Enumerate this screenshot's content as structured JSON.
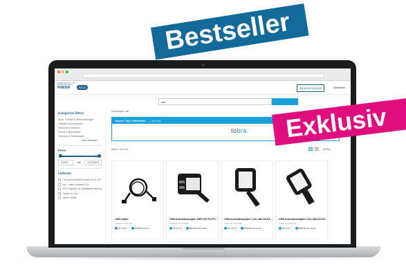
{
  "banners": {
    "bestseller": "Bestseller",
    "exklusiv": "Exklusiv"
  },
  "header": {
    "logo_line1": "PRODUCT",
    "logo_line2": "FINDER",
    "beta": "BETA",
    "btn1": "INSERAT/SUCHE",
    "btn2": "Startseite"
  },
  "search": {
    "value": "usb"
  },
  "sidebar": {
    "categories_title": "Kategorien filtern",
    "categories": [
      "Sport, Freizeit & Veranstaltungen",
      "Lifestyle & Accessoires",
      "Haushalt & Wohnen",
      "Schule & Bürobedarf",
      "Services & Technologien"
    ],
    "more": "mehr anzeigen",
    "price_title": "Preis",
    "price_min": "0,00 €",
    "price_sep": "bis",
    "price_max": "1.071,00 €",
    "suppliers_title": "Lieferant",
    "suppliers": [
      "Jhonny Hemmerle GmbH & Co. KG",
      "ad + value solutions UG",
      "ACG Agentur für Qualitätssicherung",
      "Hubert & Lutz",
      "Arlett GmbH"
    ]
  },
  "main": {
    "breadcrumb": "Suchbegriff: usb",
    "top_suppliers": "Unsere Top-Lieferanten",
    "top_suppliers_sub": "— Anzeige",
    "tobra_a": "to",
    "tobra_b": "bra",
    "page_info": "Seite 1 von 125",
    "per_page": "24 Pro",
    "products": [
      {
        "title": "USB Kabel",
        "sub": "Artikel-Nr. 6371-01",
        "seller": "ab 0,55 €",
        "brand": "EUROSTYLE G..."
      },
      {
        "title": "USB Autoladeadapter REFLECTS-FO...",
        "sub": "Artikel-Nr. 0143-05B",
        "seller": "ab 3,27 €",
        "brand": "REFLECTS GmbH"
      },
      {
        "title": "USB Autoladeadapter LOLLIBLOCKS...",
        "sub": "Artikel-Nr. 0143-0B",
        "seller": "ab 3,27 €",
        "brand": "REFLECTS GmbH"
      },
      {
        "title": "USB Autoladeadapter LOLLIBLOCKS...",
        "sub": "Artikel-Nr. 0143-04",
        "seller": "ab 3,27 €",
        "brand": "REFLECTS GmbH"
      }
    ]
  },
  "colors": {
    "brand": "#1b5e8a",
    "accent": "#1aa0dc",
    "bestseller": "#116a99",
    "exklusiv": "#e00d7f"
  }
}
